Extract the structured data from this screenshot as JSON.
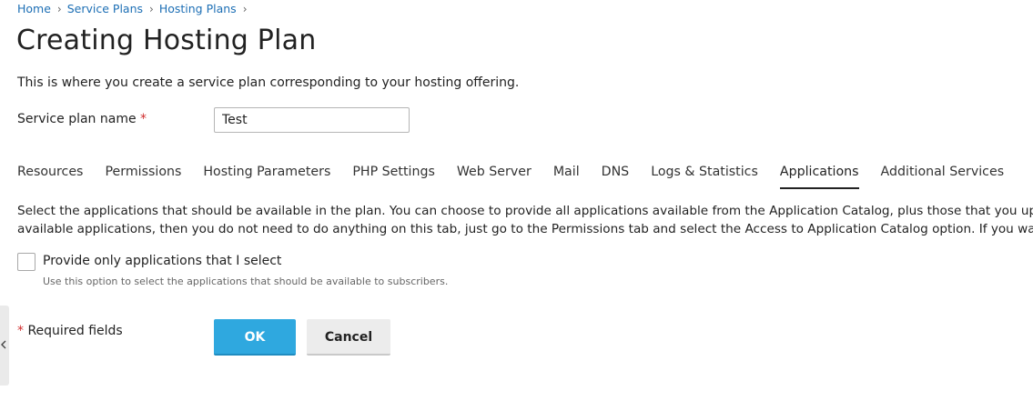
{
  "breadcrumb": {
    "items": [
      "Home",
      "Service Plans",
      "Hosting Plans"
    ]
  },
  "page": {
    "title": "Creating Hosting Plan",
    "description": "This is where you create a service plan corresponding to your hosting offering."
  },
  "form": {
    "name_label": "Service plan name",
    "required_marker": "*",
    "name_value": "Test"
  },
  "tabs": [
    {
      "label": "Resources",
      "active": false
    },
    {
      "label": "Permissions",
      "active": false
    },
    {
      "label": "Hosting Parameters",
      "active": false
    },
    {
      "label": "PHP Settings",
      "active": false
    },
    {
      "label": "Web Server",
      "active": false
    },
    {
      "label": "Mail",
      "active": false
    },
    {
      "label": "DNS",
      "active": false
    },
    {
      "label": "Logs & Statistics",
      "active": false
    },
    {
      "label": "Applications",
      "active": true
    },
    {
      "label": "Additional Services",
      "active": false
    }
  ],
  "applications_tab": {
    "description_line1": "Select the applications that should be available in the plan. You can choose to provide all applications available from the Application Catalog, plus those that you uploaded t",
    "description_line2": "available applications, then you do not need to do anything on this tab, just go to the Permissions tab and select the Access to Application Catalog option. If you want to sele",
    "checkbox_label": "Provide only applications that I select",
    "checkbox_checked": false,
    "checkbox_hint": "Use this option to select the applications that should be available to subscribers."
  },
  "footer": {
    "required_marker": "*",
    "required_note": " Required fields",
    "ok_label": "OK",
    "cancel_label": "Cancel"
  },
  "colors": {
    "link": "#1d6fb5",
    "primary_button": "#2fa8df",
    "required": "#d02d2d"
  },
  "icons": {
    "breadcrumb_separator": "chevron-right-icon",
    "side_toggle": "chevron-left-icon"
  }
}
